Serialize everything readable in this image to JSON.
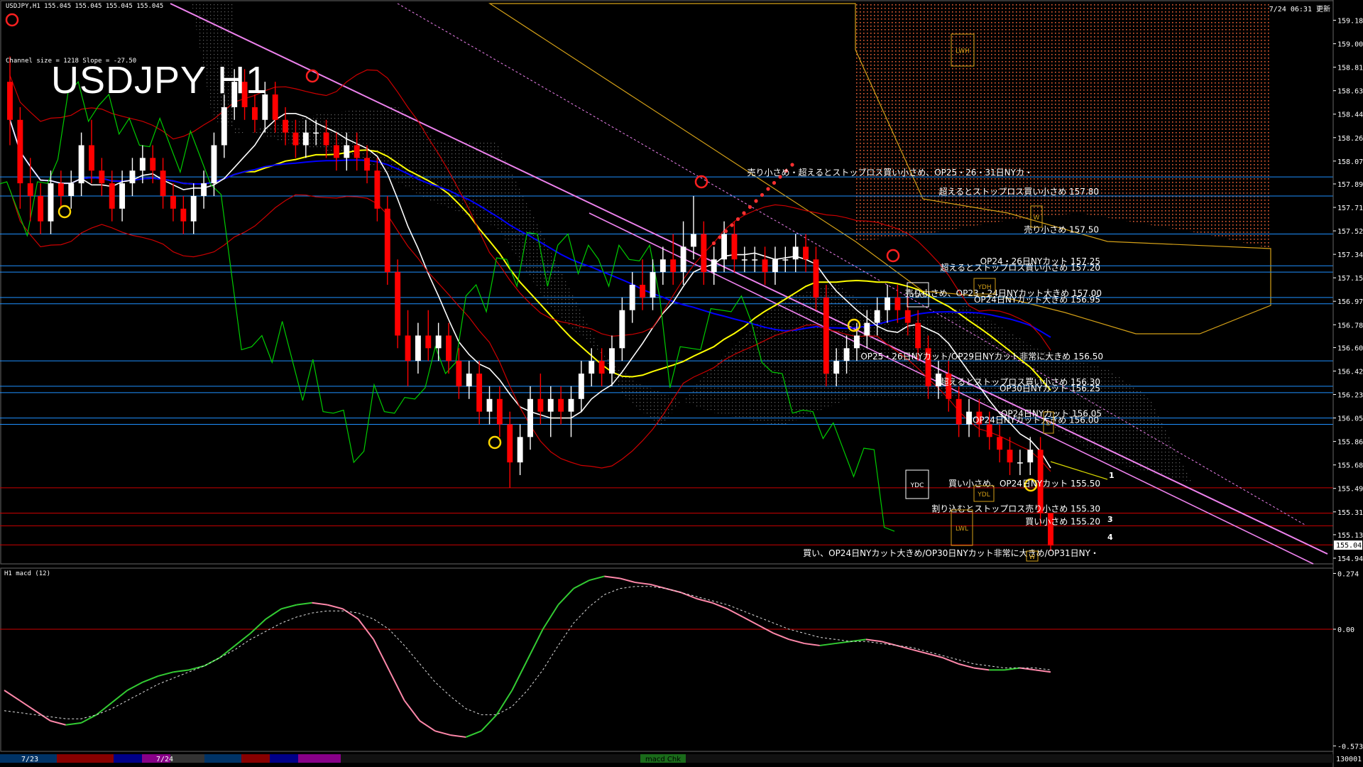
{
  "header": {
    "symbol_line": "USDJPY,H1  155.045 155.045 155.045 155.045",
    "big_title": "USDJPY H1",
    "datetime": "7/24 06:31 更新",
    "channel_info": "Channel size = 1218 Slope = -27.50"
  },
  "price_axis": {
    "labels": [
      "159.185",
      "159.000",
      "158.815",
      "158.630",
      "158.445",
      "158.260",
      "158.075",
      "157.895",
      "157.710",
      "157.525",
      "157.340",
      "157.155",
      "156.970",
      "156.785",
      "156.605",
      "156.420",
      "156.235",
      "156.050",
      "155.865",
      "155.680",
      "155.495",
      "155.310",
      "155.130",
      "154.945"
    ],
    "current_price": "155.045"
  },
  "annotations": [
    "売り小さめ・超えるとストップロス買い小さめ、OP25・26・31日NYカ・",
    "超えるとストップロス買い小さめ 157.80",
    "売り小さめ 157.50",
    "OP24・26日NYカット 157.25",
    "超えるとストップロス買い小さめ 157.20",
    "売り小さめ、OP23・24日NYカット大きめ 157.00",
    "OP24日NYカット大きめ 156.95",
    "OP25・26日NYカット/OP29日NYカット非常に大きめ 156.50",
    "超えるとストップロス買い小さめ 156.30",
    "OP30日NYカット 156.25",
    "OP24日NYカット 156.05",
    "OP24日NYカット大きめ 156.00",
    "買い小さめ、OP24日NYカット 155.50",
    "割り込むとストップロス売り小さめ 155.30",
    "買い小さめ 155.20",
    "買い、OP24日NYカット大きめ/OP30日NYカット非常に大きめ/OP31日NY・"
  ],
  "box_labels": [
    "LWH",
    "YDH",
    "YDO",
    "YDC",
    "YDL",
    "LWL",
    "W",
    "W",
    "D"
  ],
  "channel_numbers": [
    "1",
    "3",
    "4"
  ],
  "macd": {
    "title": "H1  macd (12)",
    "axis_labels": [
      "0.274",
      "0.00",
      "-0.573"
    ],
    "badge": "macd Chk",
    "bottom_number": "130001"
  },
  "date_labels": [
    "7/23",
    "7/24"
  ],
  "colors": {
    "background": "#000000",
    "bull_candle": "#ffffff",
    "bear_candle": "#ff0000",
    "cloud_bear": "#ff6a3c",
    "cloud_bull": "#ffffff",
    "channel": "#ee82ee",
    "ma_blue": "#0000ff",
    "ma_yellow": "#ffff00",
    "ma_white": "#ffffff",
    "bands": "#cc0000",
    "chikou": "#00cc00",
    "hline": "#1e90ff",
    "macd_up": "#33cc33",
    "macd_down": "#ff88aa"
  },
  "chart_data": [
    {
      "type": "candlestick",
      "title": "USDJPY H1",
      "ylim": [
        154.9,
        159.3
      ],
      "ohlc": [
        [
          158.7,
          158.9,
          158.2,
          158.4
        ],
        [
          158.4,
          158.5,
          157.7,
          157.9
        ],
        [
          157.9,
          158.1,
          157.6,
          157.8
        ],
        [
          157.8,
          157.9,
          157.5,
          157.6
        ],
        [
          157.6,
          158.0,
          157.5,
          157.9
        ],
        [
          157.9,
          158.0,
          157.7,
          157.8
        ],
        [
          157.8,
          158.0,
          157.7,
          157.9
        ],
        [
          157.9,
          158.3,
          157.8,
          158.2
        ],
        [
          158.2,
          158.4,
          157.9,
          158.0
        ],
        [
          158.0,
          158.1,
          157.8,
          157.9
        ],
        [
          157.9,
          158.0,
          157.6,
          157.7
        ],
        [
          157.7,
          158.0,
          157.6,
          157.9
        ],
        [
          157.9,
          158.1,
          157.8,
          158.0
        ],
        [
          158.0,
          158.2,
          157.9,
          158.1
        ],
        [
          158.1,
          158.2,
          157.9,
          158.0
        ],
        [
          158.0,
          158.1,
          157.7,
          157.8
        ],
        [
          157.8,
          157.9,
          157.6,
          157.7
        ],
        [
          157.7,
          157.8,
          157.5,
          157.6
        ],
        [
          157.6,
          157.9,
          157.5,
          157.8
        ],
        [
          157.8,
          158.0,
          157.7,
          157.9
        ],
        [
          157.9,
          158.3,
          157.8,
          158.2
        ],
        [
          158.2,
          158.6,
          158.1,
          158.5
        ],
        [
          158.5,
          158.8,
          158.4,
          158.7
        ],
        [
          158.7,
          158.8,
          158.4,
          158.5
        ],
        [
          158.5,
          158.6,
          158.3,
          158.4
        ],
        [
          158.4,
          158.7,
          158.3,
          158.6
        ],
        [
          158.6,
          158.7,
          158.3,
          158.4
        ],
        [
          158.4,
          158.5,
          158.2,
          158.3
        ],
        [
          158.3,
          158.4,
          158.1,
          158.2
        ],
        [
          158.2,
          158.4,
          158.1,
          158.3
        ],
        [
          158.3,
          158.4,
          158.2,
          158.3
        ],
        [
          158.3,
          158.4,
          158.1,
          158.2
        ],
        [
          158.2,
          158.3,
          158.0,
          158.1
        ],
        [
          158.1,
          158.3,
          158.0,
          158.2
        ],
        [
          158.2,
          158.3,
          158.0,
          158.1
        ],
        [
          158.1,
          158.2,
          157.9,
          158.0
        ],
        [
          158.0,
          158.1,
          157.6,
          157.7
        ],
        [
          157.7,
          157.8,
          157.1,
          157.2
        ],
        [
          157.2,
          157.3,
          156.6,
          156.7
        ],
        [
          156.7,
          156.9,
          156.3,
          156.5
        ],
        [
          156.5,
          156.8,
          156.4,
          156.7
        ],
        [
          156.7,
          156.9,
          156.5,
          156.6
        ],
        [
          156.6,
          156.8,
          156.5,
          156.7
        ],
        [
          156.7,
          156.8,
          156.4,
          156.5
        ],
        [
          156.5,
          156.6,
          156.2,
          156.3
        ],
        [
          156.3,
          156.5,
          156.2,
          156.4
        ],
        [
          156.4,
          156.5,
          156.0,
          156.1
        ],
        [
          156.1,
          156.3,
          156.0,
          156.2
        ],
        [
          156.2,
          156.3,
          155.9,
          156.0
        ],
        [
          156.0,
          156.1,
          155.5,
          155.7
        ],
        [
          155.7,
          156.0,
          155.6,
          155.9
        ],
        [
          155.9,
          156.3,
          155.8,
          156.2
        ],
        [
          156.2,
          156.4,
          156.0,
          156.1
        ],
        [
          156.1,
          156.3,
          155.9,
          156.2
        ],
        [
          156.2,
          156.3,
          156.0,
          156.1
        ],
        [
          156.1,
          156.3,
          155.9,
          156.2
        ],
        [
          156.2,
          156.5,
          156.1,
          156.4
        ],
        [
          156.4,
          156.6,
          156.3,
          156.5
        ],
        [
          156.5,
          156.6,
          156.3,
          156.4
        ],
        [
          156.4,
          156.7,
          156.3,
          156.6
        ],
        [
          156.6,
          157.0,
          156.5,
          156.9
        ],
        [
          156.9,
          157.2,
          156.8,
          157.1
        ],
        [
          157.1,
          157.3,
          156.9,
          157.0
        ],
        [
          157.0,
          157.3,
          156.9,
          157.2
        ],
        [
          157.2,
          157.4,
          157.1,
          157.3
        ],
        [
          157.3,
          157.5,
          157.1,
          157.2
        ],
        [
          157.2,
          157.6,
          157.1,
          157.4
        ],
        [
          157.4,
          157.8,
          157.3,
          157.5
        ],
        [
          157.5,
          157.6,
          157.1,
          157.2
        ],
        [
          157.2,
          157.4,
          157.1,
          157.3
        ],
        [
          157.3,
          157.6,
          157.2,
          157.5
        ],
        [
          157.5,
          157.6,
          157.2,
          157.3
        ],
        [
          157.3,
          157.4,
          157.2,
          157.3
        ],
        [
          157.3,
          157.4,
          157.2,
          157.3
        ],
        [
          157.3,
          157.4,
          157.1,
          157.2
        ],
        [
          157.2,
          157.4,
          157.1,
          157.3
        ],
        [
          157.3,
          157.4,
          157.2,
          157.3
        ],
        [
          157.3,
          157.5,
          157.2,
          157.4
        ],
        [
          157.4,
          157.5,
          157.2,
          157.3
        ],
        [
          157.3,
          157.4,
          156.9,
          157.0
        ],
        [
          157.0,
          157.1,
          156.3,
          156.4
        ],
        [
          156.4,
          156.6,
          156.3,
          156.5
        ],
        [
          156.5,
          156.7,
          156.4,
          156.6
        ],
        [
          156.6,
          156.8,
          156.5,
          156.7
        ],
        [
          156.7,
          156.9,
          156.6,
          156.8
        ],
        [
          156.8,
          157.0,
          156.7,
          156.9
        ],
        [
          156.9,
          157.1,
          156.8,
          157.0
        ],
        [
          157.0,
          157.1,
          156.8,
          156.9
        ],
        [
          156.9,
          157.0,
          156.7,
          156.8
        ],
        [
          156.8,
          156.9,
          156.5,
          156.6
        ],
        [
          156.6,
          156.7,
          156.2,
          156.3
        ],
        [
          156.3,
          156.5,
          156.2,
          156.4
        ],
        [
          156.4,
          156.5,
          156.1,
          156.2
        ],
        [
          156.2,
          156.3,
          155.9,
          156.0
        ],
        [
          156.0,
          156.2,
          155.9,
          156.1
        ],
        [
          156.1,
          156.2,
          155.9,
          156.0
        ],
        [
          156.0,
          156.1,
          155.8,
          155.9
        ],
        [
          155.9,
          156.0,
          155.7,
          155.8
        ],
        [
          155.8,
          155.9,
          155.6,
          155.7
        ],
        [
          155.7,
          155.8,
          155.6,
          155.7
        ],
        [
          155.7,
          155.9,
          155.6,
          155.8
        ],
        [
          155.8,
          155.9,
          155.2,
          155.3
        ],
        [
          155.3,
          155.3,
          155.0,
          155.045
        ]
      ]
    },
    {
      "type": "line",
      "title": "H1  macd (12)",
      "ylim": [
        -0.6,
        0.3
      ],
      "series": [
        {
          "values": [
            -0.3,
            -0.35,
            -0.4,
            -0.45,
            -0.47,
            -0.46,
            -0.42,
            -0.36,
            -0.3,
            -0.26,
            -0.23,
            -0.21,
            -0.2,
            -0.18,
            -0.14,
            -0.08,
            -0.02,
            0.05,
            0.1,
            0.12,
            0.13,
            0.12,
            0.1,
            0.05,
            -0.05,
            -0.2,
            -0.35,
            -0.45,
            -0.5,
            -0.52,
            -0.53,
            -0.5,
            -0.42,
            -0.3,
            -0.15,
            0.0,
            0.12,
            0.2,
            0.24,
            0.26,
            0.25,
            0.23,
            0.22,
            0.2,
            0.18,
            0.15,
            0.13,
            0.1,
            0.06,
            0.02,
            -0.02,
            -0.05,
            -0.07,
            -0.08,
            -0.07,
            -0.06,
            -0.05,
            -0.06,
            -0.08,
            -0.1,
            -0.12,
            -0.14,
            -0.17,
            -0.19,
            -0.2,
            -0.2,
            -0.19,
            -0.2,
            -0.21
          ]
        },
        {
          "values": [
            -0.4,
            -0.41,
            -0.42,
            -0.43,
            -0.44,
            -0.44,
            -0.42,
            -0.39,
            -0.35,
            -0.31,
            -0.27,
            -0.24,
            -0.21,
            -0.18,
            -0.14,
            -0.1,
            -0.05,
            -0.01,
            0.03,
            0.06,
            0.08,
            0.09,
            0.09,
            0.08,
            0.05,
            0.0,
            -0.08,
            -0.17,
            -0.26,
            -0.33,
            -0.39,
            -0.42,
            -0.42,
            -0.38,
            -0.3,
            -0.2,
            -0.08,
            0.03,
            0.11,
            0.17,
            0.2,
            0.21,
            0.21,
            0.2,
            0.18,
            0.16,
            0.14,
            0.12,
            0.09,
            0.06,
            0.03,
            0.0,
            -0.02,
            -0.04,
            -0.05,
            -0.06,
            -0.06,
            -0.07,
            -0.08,
            -0.09,
            -0.11,
            -0.13,
            -0.15,
            -0.17,
            -0.18,
            -0.19,
            -0.19,
            -0.19,
            -0.2
          ]
        }
      ]
    }
  ]
}
